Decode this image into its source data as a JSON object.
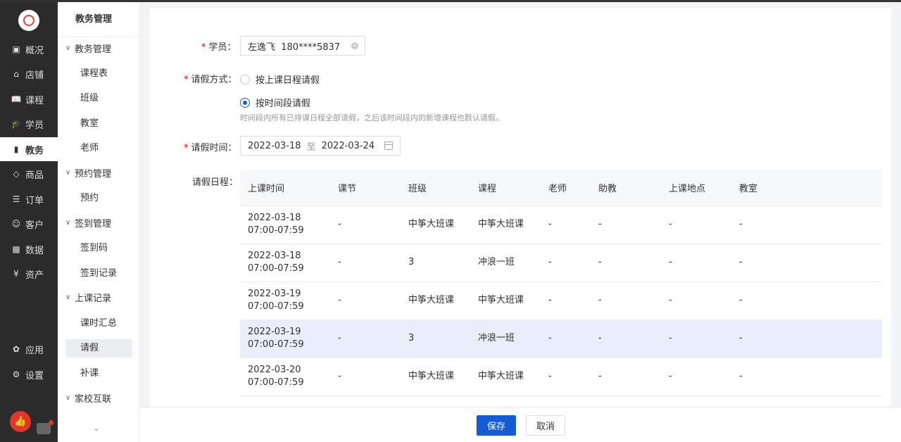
{
  "nav1": {
    "items": [
      {
        "label": "概况",
        "icon": "overview-icon"
      },
      {
        "label": "店铺",
        "icon": "shop-icon"
      },
      {
        "label": "课程",
        "icon": "book-icon"
      },
      {
        "label": "学员",
        "icon": "student-icon"
      },
      {
        "label": "教务",
        "icon": "academic-icon"
      },
      {
        "label": "商品",
        "icon": "tag-icon"
      },
      {
        "label": "订单",
        "icon": "order-icon"
      },
      {
        "label": "客户",
        "icon": "customer-icon"
      },
      {
        "label": "数据",
        "icon": "data-icon"
      },
      {
        "label": "资产",
        "icon": "asset-icon"
      },
      {
        "label": "应用",
        "icon": "apps-icon"
      },
      {
        "label": "设置",
        "icon": "settings-icon"
      }
    ],
    "active": "教务"
  },
  "nav2": {
    "title": "教务管理",
    "groups": [
      {
        "label": "教务管理",
        "items": [
          "课程表",
          "班级",
          "教室",
          "老师"
        ]
      },
      {
        "label": "预约管理",
        "items": [
          "预约"
        ]
      },
      {
        "label": "签到管理",
        "items": [
          "签到码",
          "签到记录"
        ]
      },
      {
        "label": "上课记录",
        "items": [
          "课时汇总",
          "请假",
          "补课"
        ]
      },
      {
        "label": "家校互联",
        "items": []
      }
    ],
    "active": "请假"
  },
  "form": {
    "student_label": "学员：",
    "student_value": "左逸飞  180****5837",
    "mode_label": "请假方式：",
    "mode_option1": "按上课日程请假",
    "mode_option2": "按时间段请假",
    "mode_selected": "按时间段请假",
    "mode_hint": "时间段内所有已排课日程全部请假，之后该时间段内的新增课程也默认请假。",
    "time_label": "请假时间：",
    "date_start": "2022-03-18",
    "date_sep": "至",
    "date_end": "2022-03-24",
    "schedule_label": "请假日程："
  },
  "table": {
    "headers": [
      "上课时间",
      "课节",
      "班级",
      "课程",
      "老师",
      "助教",
      "上课地点",
      "教室"
    ],
    "rows": [
      {
        "date": "2022-03-18",
        "time": "07:00-07:59",
        "lesson": "-",
        "class": "中筝大班课",
        "course": "中筝大班课",
        "teacher": "-",
        "assistant": "-",
        "place": "-",
        "room": "-"
      },
      {
        "date": "2022-03-18",
        "time": "07:00-07:59",
        "lesson": "-",
        "class": "3",
        "course": "冲浪一班",
        "teacher": "-",
        "assistant": "-",
        "place": "-",
        "room": "-"
      },
      {
        "date": "2022-03-19",
        "time": "07:00-07:59",
        "lesson": "-",
        "class": "中筝大班课",
        "course": "中筝大班课",
        "teacher": "-",
        "assistant": "-",
        "place": "-",
        "room": "-"
      },
      {
        "date": "2022-03-19",
        "time": "07:00-07:59",
        "lesson": "-",
        "class": "3",
        "course": "冲浪一班",
        "teacher": "-",
        "assistant": "-",
        "place": "-",
        "room": "-",
        "highlight": true
      },
      {
        "date": "2022-03-20",
        "time": "07:00-07:59",
        "lesson": "-",
        "class": "中筝大班课",
        "course": "中筝大班课",
        "teacher": "-",
        "assistant": "-",
        "place": "-",
        "room": "-"
      }
    ]
  },
  "footer": {
    "save": "保存",
    "cancel": "取消"
  },
  "colors": {
    "primary": "#155bd4",
    "sidebar": "#2b2b2b",
    "highlight_row": "#e8effa",
    "required": "#d40000"
  }
}
